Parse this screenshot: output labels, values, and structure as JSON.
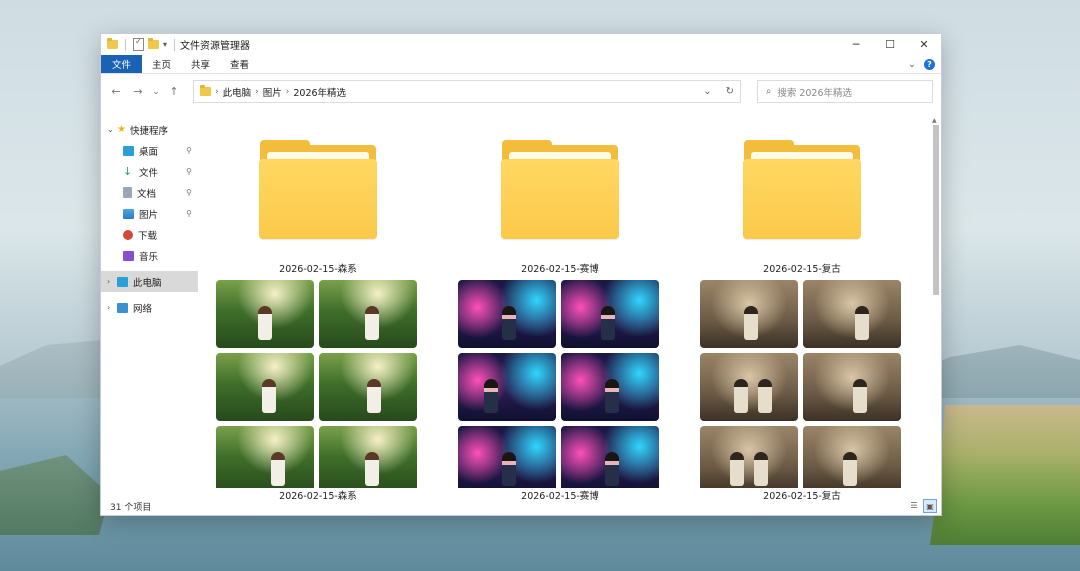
{
  "window": {
    "title": "文件资源管理器",
    "controls": {
      "minimize": "─",
      "maximize": "☐",
      "close": "✕"
    },
    "quick_access_dropdown": "▾"
  },
  "ribbon": {
    "tabs": [
      {
        "label": "文件",
        "active": true
      },
      {
        "label": "主页",
        "active": false
      },
      {
        "label": "共享",
        "active": false
      },
      {
        "label": "查看",
        "active": false
      }
    ],
    "expand": "⌄",
    "help": "?"
  },
  "nav_buttons": {
    "back": "←",
    "forward": "→",
    "recent": "⌄",
    "up": "↑"
  },
  "address": {
    "crumbs": [
      "此电脑",
      "图片",
      "2026年精选"
    ],
    "separator": "›",
    "dropdown": "⌄",
    "refresh": "↻"
  },
  "search": {
    "placeholder": "搜索 2026年精选",
    "icon": "⌕"
  },
  "sidebar": {
    "quick_access": {
      "label": "快捷程序",
      "arrow": "⌄",
      "star": "★"
    },
    "items": [
      {
        "label": "桌面",
        "icon": "desktop-icon",
        "color": "#2b9fd8",
        "pinned": true
      },
      {
        "label": "文件",
        "icon": "download-icon",
        "color": "#2aa267",
        "pinned": true
      },
      {
        "label": "文档",
        "icon": "document-icon",
        "color": "#7c8aa0",
        "pinned": true
      },
      {
        "label": "图片",
        "icon": "picture-icon",
        "color": "#2f8ad6",
        "pinned": true
      },
      {
        "label": "下载",
        "icon": "music-disc-icon",
        "color": "#d04a3a",
        "pinned": false
      },
      {
        "label": "音乐",
        "icon": "video-icon",
        "color": "#8a4fd0",
        "pinned": false
      }
    ],
    "pin_glyph": "📌",
    "this_pc": {
      "label": "此电脑",
      "arrow": "›"
    },
    "network": {
      "label": "网络",
      "arrow": "›"
    }
  },
  "folders": [
    {
      "name": "2026-02-15-森系"
    },
    {
      "name": "2026-02-15-赛博"
    },
    {
      "name": "2026-02-15-复古"
    }
  ],
  "photo_groups": [
    {
      "name": "2026-02-15-森系",
      "style": "forest"
    },
    {
      "name": "2026-02-15-赛博",
      "style": "neon"
    },
    {
      "name": "2026-02-15-复古",
      "style": "vintage"
    }
  ],
  "scroll": {
    "up_arrow": "▲"
  },
  "status": {
    "count": "31 个项目",
    "details_view": "☰",
    "large_icons_view": "▣"
  }
}
